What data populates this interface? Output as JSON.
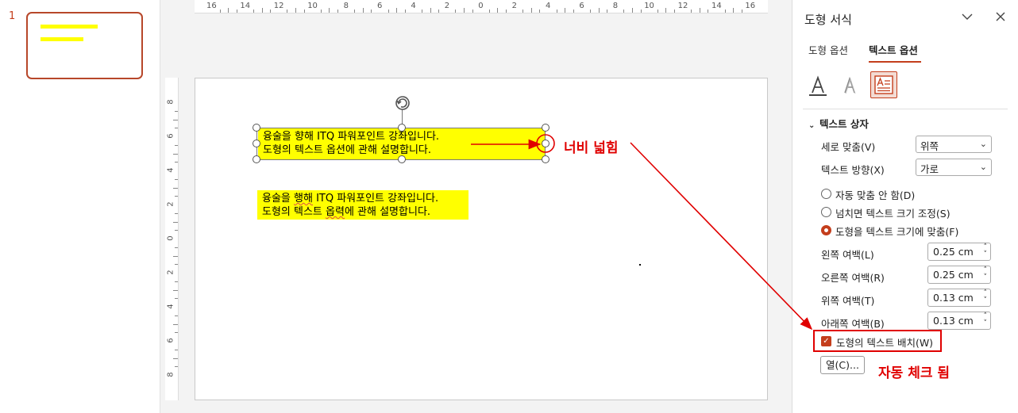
{
  "thumbs": {
    "slide_number": "1"
  },
  "slide": {
    "textbox1_line1": "융술을 향해 ITQ 파워포인트 강좌입니다.",
    "textbox1_line2": "도형의 텍스트 옵션에 관해 설명합니다.",
    "textbox2_line1_a": "융술을 ",
    "textbox2_line1_b": "행해",
    "textbox2_line1_c": " ITQ 파워포인트 강좌입니다.",
    "textbox2_line2_a": "도형의 텍스트 ",
    "textbox2_line2_b": "옵력",
    "textbox2_line2_c": "에 관해 설명합니다."
  },
  "ruler": {
    "h_labels": [
      "16",
      "14",
      "12",
      "10",
      "8",
      "6",
      "4",
      "2",
      "0",
      "2",
      "4",
      "6",
      "8",
      "10",
      "12",
      "14",
      "16"
    ],
    "v_labels": [
      "8",
      "6",
      "4",
      "2",
      "0",
      "2",
      "4",
      "6",
      "8"
    ]
  },
  "pane": {
    "title": "도형 서식",
    "tabs": [
      "도형 옵션",
      "텍스트 옵션"
    ],
    "section": "텍스트 상자",
    "vertical_align_label": "세로 맞춤(V)",
    "vertical_align_value": "위쪽",
    "text_direction_label": "텍스트 방향(X)",
    "text_direction_value": "가로",
    "radio_no_autofit": "자동 맞춤 안 함(D)",
    "radio_shrink": "넘치면 텍스트 크기 조정(S)",
    "radio_resize": "도형을 텍스트 크기에 맞춤(F)",
    "left_margin_label": "왼쪽 여백(L)",
    "left_margin_value": "0.25 cm",
    "right_margin_label": "오른쪽 여백(R)",
    "right_margin_value": "0.25 cm",
    "top_margin_label": "위쪽 여백(T)",
    "top_margin_value": "0.13 cm",
    "bottom_margin_label": "아래쪽 여백(B)",
    "bottom_margin_value": "0.13 cm",
    "wrap_text_label": "도형의 텍스트 배치(W)",
    "columns_button": "열(C)..."
  },
  "annotations": {
    "width_widened": "너비 넓힘",
    "auto_checked": "자동 체크 됨",
    "color": "#e00000"
  },
  "colors": {
    "accent": "#c43e1c",
    "highlight": "#ffff00"
  }
}
